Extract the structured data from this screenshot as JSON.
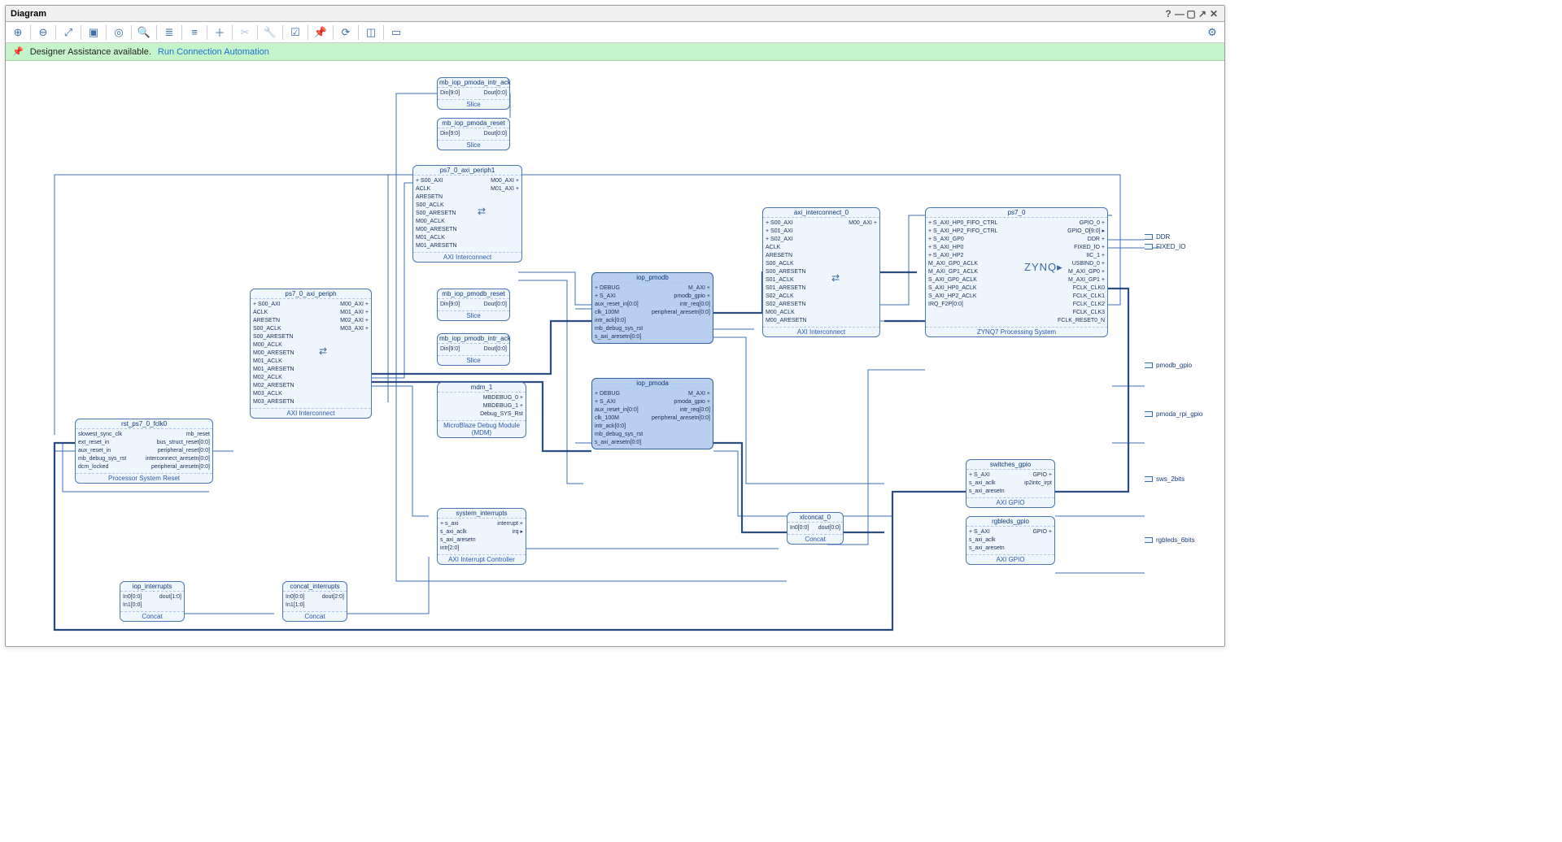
{
  "window": {
    "title": "Diagram"
  },
  "infobar": {
    "pin": "📌",
    "msg": "Designer Assistance available.",
    "link": "Run Connection Automation"
  },
  "toolbar": {
    "zoom_in": "⊕",
    "zoom_out": "⊖",
    "fit": "⤢",
    "area": "▣",
    "center": "◎",
    "search": "🔍",
    "collapse": "≣",
    "expand": "≡",
    "add": "＋",
    "cut": "✂",
    "wrench": "🔧",
    "check": "☑",
    "pin": "📌",
    "refresh": "⟳",
    "layout": "◫",
    "sub": "▭",
    "gear": "⚙"
  },
  "external_ports": {
    "ddr": "DDR",
    "fixed_io": "FIXED_IO",
    "pmodb_gpio": "pmodb_gpio",
    "pmoda_rpi_gpio": "pmoda_rpi_gpio",
    "sws_2bits": "sws_2bits",
    "rgbleds_6bits": "rgbleds_6bits"
  },
  "blocks": {
    "slice1": {
      "name": "mb_iop_pmoda_intr_ack",
      "type": "Slice",
      "in": "Din[9:0]",
      "out": "Dout[0:0]"
    },
    "slice2": {
      "name": "mb_iop_pmoda_reset",
      "type": "Slice",
      "in": "Din[9:0]",
      "out": "Dout[0:0]"
    },
    "slice3": {
      "name": "mb_iop_pmodb_reset",
      "type": "Slice",
      "in": "Din[9:0]",
      "out": "Dout[0:0]"
    },
    "slice4": {
      "name": "mb_iop_pmodb_intr_ack",
      "type": "Slice",
      "in": "Din[9:0]",
      "out": "Dout[0:0]"
    },
    "axi_periph1": {
      "name": "ps7_0_axi_periph1",
      "type": "AXI Interconnect",
      "left": [
        "+ S00_AXI",
        "ACLK",
        "ARESETN",
        "S00_ACLK",
        "S00_ARESETN",
        "M00_ACLK",
        "M00_ARESETN",
        "M01_ACLK",
        "M01_ARESETN"
      ],
      "right": [
        "M00_AXI +",
        "M01_AXI +"
      ]
    },
    "axi_periph": {
      "name": "ps7_0_axi_periph",
      "type": "AXI Interconnect",
      "left": [
        "+ S00_AXI",
        "ACLK",
        "ARESETN",
        "S00_ACLK",
        "S00_ARESETN",
        "M00_ACLK",
        "M00_ARESETN",
        "M01_ACLK",
        "M01_ARESETN",
        "M02_ACLK",
        "M02_ARESETN",
        "M03_ACLK",
        "M03_ARESETN"
      ],
      "right": [
        "M00_AXI +",
        "M01_AXI +",
        "M02_AXI +",
        "M03_AXI +"
      ]
    },
    "axi_interconnect0": {
      "name": "axi_interconnect_0",
      "type": "AXI Interconnect",
      "left": [
        "+ S00_AXI",
        "+ S01_AXI",
        "+ S02_AXI",
        "ACLK",
        "ARESETN",
        "S00_ACLK",
        "S00_ARESETN",
        "S01_ACLK",
        "S01_ARESETN",
        "S02_ACLK",
        "S02_ARESETN",
        "M00_ACLK",
        "M00_ARESETN"
      ],
      "right": [
        "M00_AXI +"
      ]
    },
    "rst": {
      "name": "rst_ps7_0_fclk0",
      "type": "Processor System Reset",
      "left": [
        "slowest_sync_clk",
        "ext_reset_in",
        "aux_reset_in",
        "mb_debug_sys_rst",
        "dcm_locked"
      ],
      "right": [
        "mb_reset",
        "bus_struct_reset[0:0]",
        "peripheral_reset[0:0]",
        "interconnect_aresetn[0:0]",
        "peripheral_aresetn[0:0]"
      ]
    },
    "mdm": {
      "name": "mdm_1",
      "type": "MicroBlaze Debug Module (MDM)",
      "right": [
        "MBDEBUG_0 +",
        "MBDEBUG_1 +",
        "Debug_SYS_Rst"
      ]
    },
    "iop_pmodb": {
      "name": "iop_pmodb",
      "type": "",
      "left": [
        "+ DEBUG",
        "+ S_AXI",
        "aux_reset_in[0:0]",
        "clk_100M",
        "intr_ack[0:0]",
        "mb_debug_sys_rst",
        "s_axi_aresetn[0:0]"
      ],
      "right": [
        "M_AXI +",
        "pmodb_gpio +",
        "intr_req[0:0]",
        "peripheral_aresetn[0:0]"
      ]
    },
    "iop_pmoda": {
      "name": "iop_pmoda",
      "type": "",
      "left": [
        "+ DEBUG",
        "+ S_AXI",
        "aux_reset_in[0:0]",
        "clk_100M",
        "intr_ack[0:0]",
        "mb_debug_sys_rst",
        "s_axi_aresetn[0:0]"
      ],
      "right": [
        "M_AXI +",
        "pmoda_gpio +",
        "intr_req[0:0]",
        "peripheral_aresetn[0:0]"
      ]
    },
    "sys_intr": {
      "name": "system_interrupts",
      "type": "AXI Interrupt Controller",
      "left": [
        "+ s_axi",
        "s_axi_aclk",
        "s_axi_aresetn",
        "intr[2:0]"
      ],
      "right": [
        "interrupt +",
        "irq ▸"
      ]
    },
    "xlconcat": {
      "name": "xlconcat_0",
      "type": "Concat",
      "left": [
        "In0[0:0]"
      ],
      "right": [
        "dout[0:0]"
      ]
    },
    "iop_intr": {
      "name": "iop_interrupts",
      "type": "Concat",
      "left": [
        "In0[0:0]",
        "In1[0:0]"
      ],
      "right": [
        "dout[1:0]"
      ]
    },
    "concat_intr": {
      "name": "concat_interrupts",
      "type": "Concat",
      "left": [
        "In0[0:0]",
        "In1[1:0]"
      ],
      "right": [
        "dout[2:0]"
      ]
    },
    "switches_gpio": {
      "name": "switches_gpio",
      "type": "AXI GPIO",
      "left": [
        "+ S_AXI",
        "s_axi_aclk",
        "s_axi_aresetn"
      ],
      "right": [
        "GPIO +",
        "ip2intc_irpt"
      ]
    },
    "rgbleds_gpio": {
      "name": "rgbleds_gpio",
      "type": "AXI GPIO",
      "left": [
        "+ S_AXI",
        "s_axi_aclk",
        "s_axi_aresetn"
      ],
      "right": [
        "GPIO +"
      ]
    },
    "ps7": {
      "name": "ps7_0",
      "type": "ZYNQ7 Processing System",
      "logo": "ZYNQ▸",
      "left": [
        "+ S_AXI_HP0_FIFO_CTRL",
        "+ S_AXI_HP2_FIFO_CTRL",
        "+ S_AXI_GP0",
        "+ S_AXI_HP0",
        "+ S_AXI_HP2",
        "M_AXI_GP0_ACLK",
        "M_AXI_GP1_ACLK",
        "S_AXI_GP0_ACLK",
        "S_AXI_HP0_ACLK",
        "S_AXI_HP2_ACLK",
        "IRQ_F2P[0:0]"
      ],
      "right": [
        "GPIO_0 +",
        "GPIO_O[9:0] ▸",
        "DDR +",
        "FIXED_IO +",
        "IIC_1 +",
        "USBIND_0 +",
        "M_AXI_GP0 +",
        "M_AXI_GP1 +",
        "FCLK_CLK0",
        "FCLK_CLK1",
        "FCLK_CLK2",
        "FCLK_CLK3",
        "FCLK_RESET0_N"
      ]
    }
  }
}
